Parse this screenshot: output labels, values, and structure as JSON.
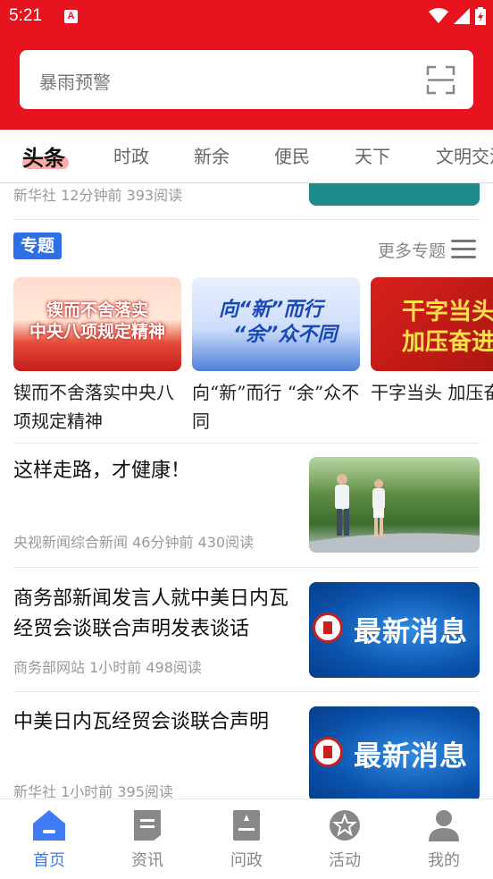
{
  "status_bar": {
    "time": "5:21",
    "app_icon_letter": "A"
  },
  "search": {
    "placeholder": "暴雨预警"
  },
  "tabs": [
    {
      "label": "头条",
      "active": true
    },
    {
      "label": "时政"
    },
    {
      "label": "新余"
    },
    {
      "label": "便民"
    },
    {
      "label": "天下"
    },
    {
      "label": "文明交流"
    }
  ],
  "partial_item": {
    "meta": "新华社 12分钟前 393阅读"
  },
  "topics": {
    "badge": "专题",
    "more_label": "更多专题",
    "cards": [
      {
        "title": "锲而不舍落实中央八项规定精神",
        "img_line1": "锲而不舍落实",
        "img_line2": "中央八项规定精神"
      },
      {
        "title": "向“新”而行 “余”众不同",
        "img_line1": "向“新”而行",
        "img_line2": "“余”众不同"
      },
      {
        "title": "干字当头 加压奋进",
        "img_line1": "干字当头",
        "img_line2": "加压奋进"
      }
    ]
  },
  "news": [
    {
      "title": "这样走路，才健康！",
      "meta": "央视新闻综合新闻 46分钟前 430阅读",
      "thumb": "walking-photo"
    },
    {
      "title": "商务部新闻发言人就中美日内瓦经贸会谈联合声明发表谈话",
      "meta": "商务部网站 1小时前 498阅读",
      "thumb": "latest-news",
      "thumb_text": "最新消息"
    },
    {
      "title": "中美日内瓦经贸会谈联合声明",
      "meta": "新华社 1小时前 395阅读",
      "thumb": "latest-news",
      "thumb_text": "最新消息"
    }
  ],
  "bottom_nav": [
    {
      "label": "首页",
      "icon": "home-icon",
      "active": true
    },
    {
      "label": "资讯",
      "icon": "news-icon"
    },
    {
      "label": "问政",
      "icon": "inquiry-icon"
    },
    {
      "label": "活动",
      "icon": "activity-icon"
    },
    {
      "label": "我的",
      "icon": "profile-icon"
    }
  ],
  "colors": {
    "brand_red": "#e7141f",
    "accent_blue": "#3e7bf5"
  }
}
